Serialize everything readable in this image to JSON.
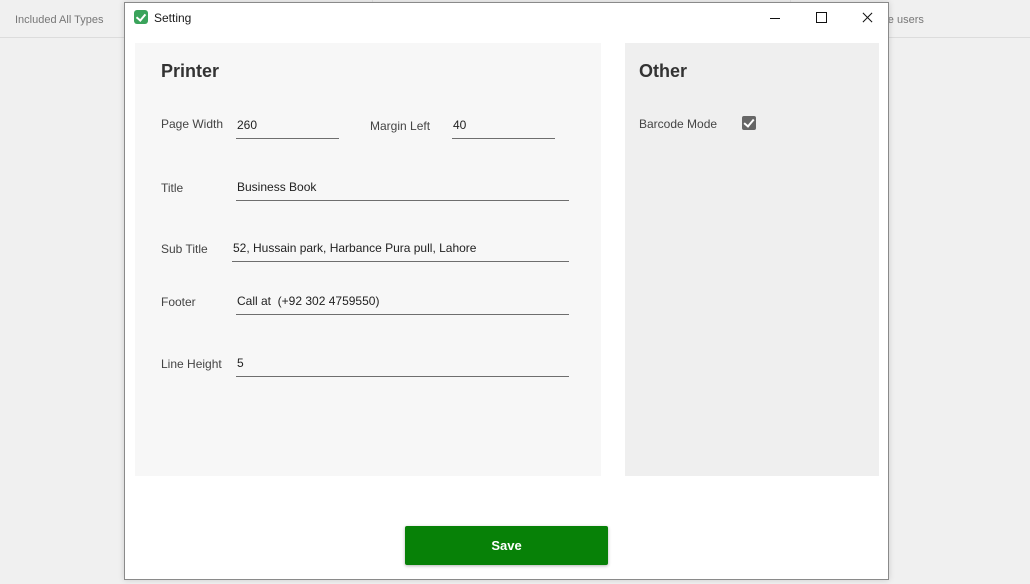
{
  "background": {
    "left_text": "Included All Types",
    "right_text": "are users"
  },
  "window": {
    "title": "Setting",
    "app_icon": "check-shield-icon"
  },
  "printer": {
    "title": "Printer",
    "page_width": {
      "label": "Page Width",
      "value": "260"
    },
    "margin_left": {
      "label": "Margin Left",
      "value": "40"
    },
    "title_field": {
      "label": "Title",
      "value": "Business Book"
    },
    "sub_title": {
      "label": "Sub Title",
      "value": "52, Hussain park, Harbance Pura pull, Lahore"
    },
    "footer": {
      "label": "Footer",
      "value": "Call at  (+92 302 4759550)"
    },
    "line_height": {
      "label": "Line Height",
      "value": "5"
    }
  },
  "other": {
    "title": "Other",
    "barcode_mode": {
      "label": "Barcode Mode",
      "checked": true
    }
  },
  "actions": {
    "save_label": "Save"
  },
  "colors": {
    "save_button": "#078107",
    "app_icon": "#3aa35b"
  }
}
